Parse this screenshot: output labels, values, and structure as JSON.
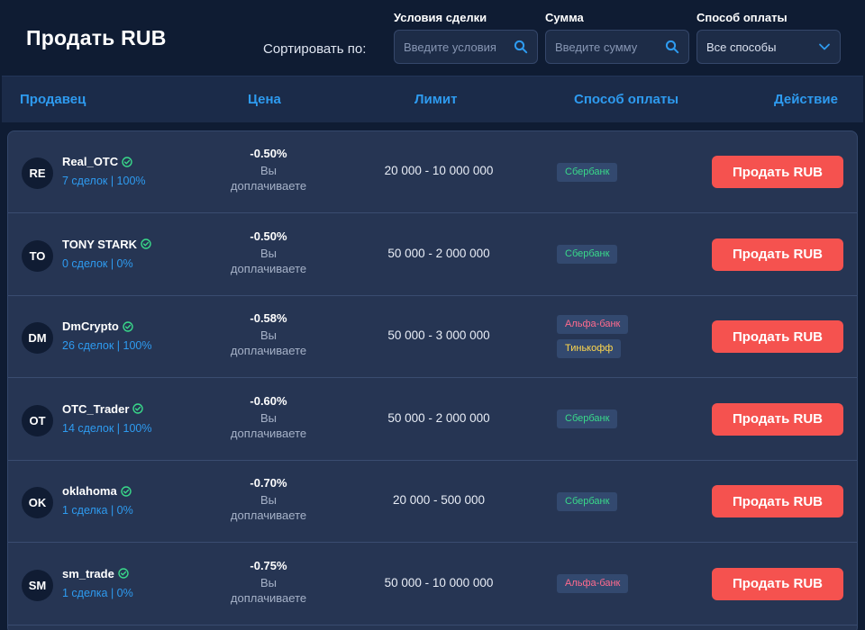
{
  "header": {
    "title": "Продать RUB",
    "sort_label": "Сортировать по:",
    "filters": {
      "conditions": {
        "label": "Условия сделки",
        "placeholder": "Введите условия"
      },
      "amount": {
        "label": "Сумма",
        "placeholder": "Введите сумму"
      },
      "payment": {
        "label": "Способ оплаты",
        "value": "Все способы"
      }
    }
  },
  "columns": {
    "seller": "Продавец",
    "price": "Цена",
    "limit": "Лимит",
    "payment": "Способ оплаты",
    "action": "Действие"
  },
  "rows": [
    {
      "initials": "RE",
      "name": "Real_OTC",
      "stats": "7 сделок | 100%",
      "percent": "-0.50%",
      "price_note": "Вы доплачиваете",
      "limit": "20 000 - 10 000 000",
      "methods": [
        {
          "label": "Сбербанк",
          "color": "#39d98a"
        }
      ],
      "action": "Продать RUB"
    },
    {
      "initials": "TO",
      "name": "TONY STARK",
      "stats": "0 сделок | 0%",
      "percent": "-0.50%",
      "price_note": "Вы доплачиваете",
      "limit": "50 000 - 2 000 000",
      "methods": [
        {
          "label": "Сбербанк",
          "color": "#39d98a"
        }
      ],
      "action": "Продать RUB"
    },
    {
      "initials": "DM",
      "name": "DmCrypto",
      "stats": "26 сделок | 100%",
      "percent": "-0.58%",
      "price_note": "Вы доплачиваете",
      "limit": "50 000 - 3 000 000",
      "methods": [
        {
          "label": "Альфа-банк",
          "color": "#ff6b8e"
        },
        {
          "label": "Тинькофф",
          "color": "#ffd84d"
        }
      ],
      "action": "Продать RUB"
    },
    {
      "initials": "OT",
      "name": "OTC_Trader",
      "stats": "14 сделок | 100%",
      "percent": "-0.60%",
      "price_note": "Вы доплачиваете",
      "limit": "50 000 - 2 000 000",
      "methods": [
        {
          "label": "Сбербанк",
          "color": "#39d98a"
        }
      ],
      "action": "Продать RUB"
    },
    {
      "initials": "OK",
      "name": "oklahoma",
      "stats": "1 сделка | 0%",
      "percent": "-0.70%",
      "price_note": "Вы доплачиваете",
      "limit": "20 000 - 500 000",
      "methods": [
        {
          "label": "Сбербанк",
          "color": "#39d98a"
        }
      ],
      "action": "Продать RUB"
    },
    {
      "initials": "SM",
      "name": "sm_trade",
      "stats": "1 сделка | 0%",
      "percent": "-0.75%",
      "price_note": "Вы доплачиваете",
      "limit": "50 000 - 10 000 000",
      "methods": [
        {
          "label": "Альфа-банк",
          "color": "#ff6b8e"
        }
      ],
      "action": "Продать RUB"
    }
  ],
  "icons": {
    "search": "search-icon",
    "dropdown": "chevron-down-icon",
    "verified": "verified-check-icon"
  },
  "colors": {
    "accent_blue": "#2e9bf0",
    "sell_button": "#f5524f",
    "verified_green": "#39d98a"
  }
}
